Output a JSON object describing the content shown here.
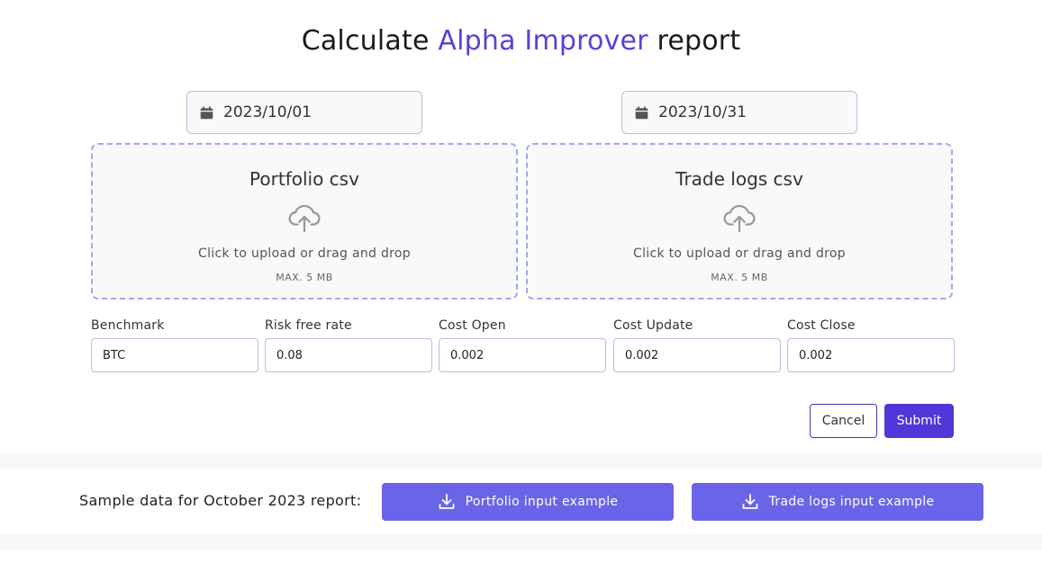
{
  "title": {
    "prefix": "Calculate",
    "accent": "Alpha Improver",
    "suffix": "report"
  },
  "dates": {
    "start": "2023/10/01",
    "end": "2023/10/31"
  },
  "uploads": {
    "portfolio": {
      "title": "Portfolio csv",
      "instruction": "Click to upload or drag and drop",
      "max": "MAX. 5 MB"
    },
    "trade_logs": {
      "title": "Trade logs csv",
      "instruction": "Click to upload or drag and drop",
      "max": "MAX. 5 MB"
    }
  },
  "params": {
    "benchmark": {
      "label": "Benchmark",
      "value": "BTC"
    },
    "risk_free_rate": {
      "label": "Risk free rate",
      "value": "0.08"
    },
    "cost_open": {
      "label": "Cost Open",
      "value": "0.002"
    },
    "cost_update": {
      "label": "Cost Update",
      "value": "0.002"
    },
    "cost_close": {
      "label": "Cost Close",
      "value": "0.002"
    }
  },
  "actions": {
    "cancel": "Cancel",
    "submit": "Submit"
  },
  "samples": {
    "label": "Sample data for October 2023 report:",
    "portfolio_button": "Portfolio input example",
    "trade_logs_button": "Trade logs input example"
  },
  "icons": {
    "date": "calendar-icon",
    "upload": "cloud-upload-icon",
    "download": "download-icon"
  },
  "colors": {
    "accent": "#5b3fd6",
    "primary_button": "#5136d9",
    "download_button": "#6a64e8",
    "border": "#b9bde6",
    "dropzone_border": "#9ea8ef"
  }
}
